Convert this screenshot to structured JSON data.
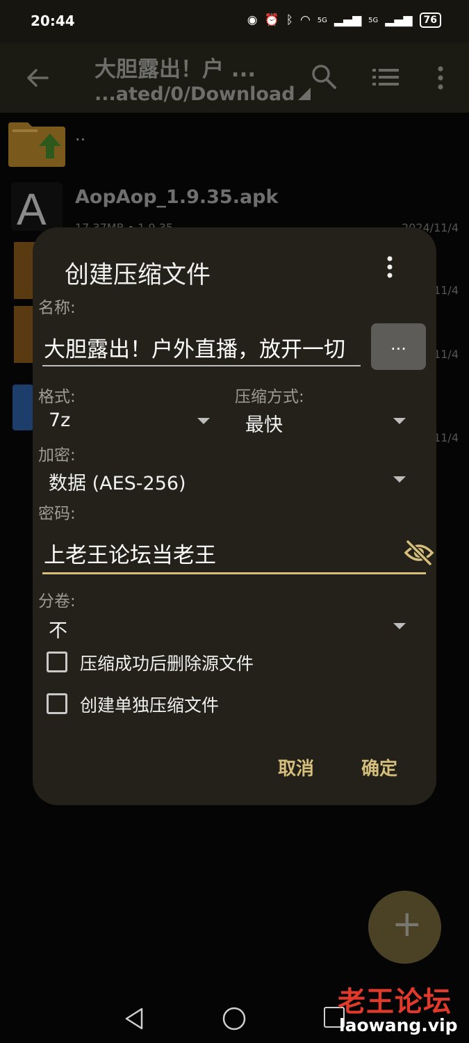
{
  "status_bar": {
    "time": "20:44",
    "network1": "5G",
    "network2": "5G",
    "battery": "76"
  },
  "app_bar": {
    "title": "大胆露出！户 ...",
    "subtitle": "...ated/0/Download"
  },
  "file_list": {
    "parent_label": "..",
    "items": [
      {
        "name": "AopAop_1.9.35.apk",
        "meta": "17.37MB  •  1.9.35",
        "date": "2024/11/4",
        "icon_letter": "A"
      },
      {
        "date": "11/4"
      },
      {
        "date": "11/4"
      },
      {
        "date": "11/4"
      }
    ]
  },
  "dialog": {
    "title": "创建压缩文件",
    "name_label": "名称:",
    "name_value": "大胆露出！户外直播，放开一切",
    "browse_label": "...",
    "format_label": "格式:",
    "format_value": "7z",
    "method_label": "压缩方式:",
    "method_value": "最快",
    "encryption_label": "加密:",
    "encryption_value": "数据 (AES-256)",
    "password_label": "密码:",
    "password_value": "上老王论坛当老王",
    "split_label": "分卷:",
    "split_value": "不",
    "option_delete_source": {
      "label": "压缩成功后删除源文件",
      "checked": false
    },
    "option_separate": {
      "label": "创建单独压缩文件",
      "checked": false
    },
    "cancel_label": "取消",
    "ok_label": "确定"
  },
  "fab": {
    "label": "+"
  },
  "watermark": {
    "line1": "老王论坛",
    "line2": "laowang.vip"
  },
  "colors": {
    "accent": "#d6bf7c",
    "dialog_bg": "#232119",
    "appbar_bg": "#1b1a13"
  }
}
